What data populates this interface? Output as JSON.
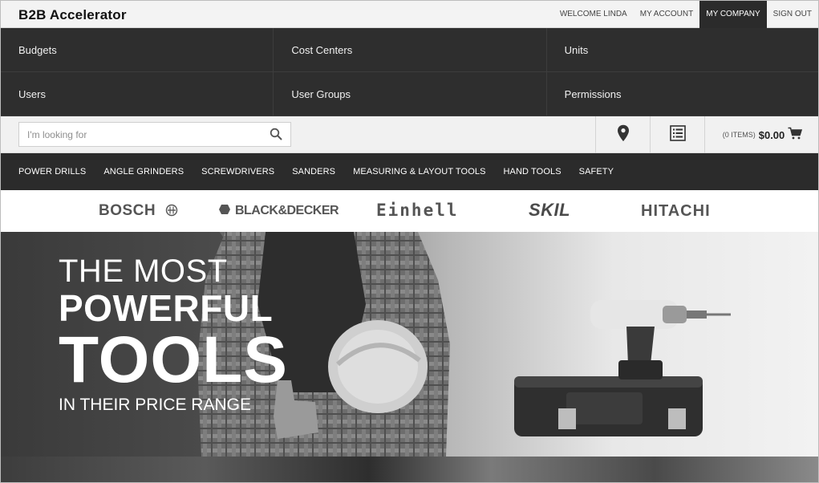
{
  "header": {
    "brand": "B2B Accelerator",
    "links": [
      {
        "label": "WELCOME LINDA"
      },
      {
        "label": "MY ACCOUNT"
      },
      {
        "label": "MY COMPANY",
        "active": true
      },
      {
        "label": "SIGN OUT"
      }
    ]
  },
  "company_menu": {
    "rows": [
      [
        "Budgets",
        "Cost Centers",
        "Units"
      ],
      [
        "Users",
        "User Groups",
        "Permissions"
      ]
    ]
  },
  "search": {
    "placeholder": "I'm looking for",
    "value": ""
  },
  "cart": {
    "items_text": "(0 ITEMS)",
    "total": "$0.00"
  },
  "categories": [
    "POWER DRILLS",
    "ANGLE GRINDERS",
    "SCREWDRIVERS",
    "SANDERS",
    "MEASURING & LAYOUT TOOLS",
    "HAND TOOLS",
    "SAFETY"
  ],
  "brands": [
    "BOSCH",
    "BLACK&DECKER",
    "Einhell",
    "SKIL",
    "HITACHI"
  ],
  "hero": {
    "line1": "THE MOST",
    "line2": "POWERFUL",
    "line3": "TOOLS",
    "line4": "IN THEIR PRICE RANGE"
  },
  "icons": {
    "search": "search-icon",
    "store": "map-pin-icon",
    "quick_order": "list-icon",
    "cart": "cart-icon"
  }
}
